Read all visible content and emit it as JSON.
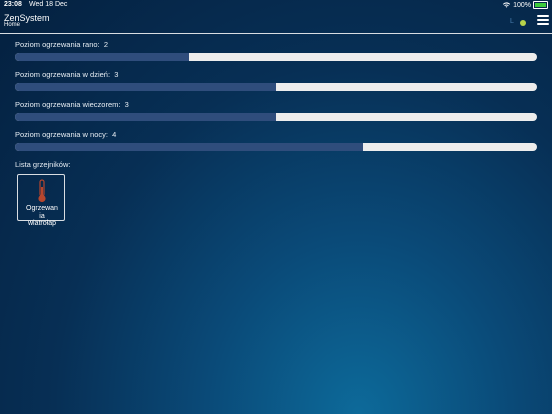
{
  "statusbar": {
    "time": "23:08",
    "date": "Wed 18 Dec",
    "battery_text": "100%",
    "battery_level": 1.0,
    "battery_color": "#3ccb3c"
  },
  "header": {
    "title": "ZenSystem",
    "subtitle": "Home",
    "indicator_letter": "L",
    "status_dot_color": "#b7d34a"
  },
  "levels": [
    {
      "label": "Poziom ogrzewania rano:",
      "value": "2",
      "fill_percent": 33.3
    },
    {
      "label": "Poziom ogrzewania w dzień:",
      "value": "3",
      "fill_percent": 50
    },
    {
      "label": "Poziom ogrzewania wieczorem:",
      "value": "3",
      "fill_percent": 50
    },
    {
      "label": "Poziom ogrzewania w nocy:",
      "value": "4",
      "fill_percent": 66.7
    }
  ],
  "heaters": {
    "title": "Lista grzejników:",
    "items": [
      {
        "name_line1": "Ogrzewan",
        "name_line2": "ia",
        "name_line3": "wiatrołap",
        "icon": "thermometer-icon"
      }
    ]
  },
  "colors": {
    "slider_fill": "#2f4d7c",
    "slider_track": "#ededed",
    "thermometer": "#b5462e"
  }
}
